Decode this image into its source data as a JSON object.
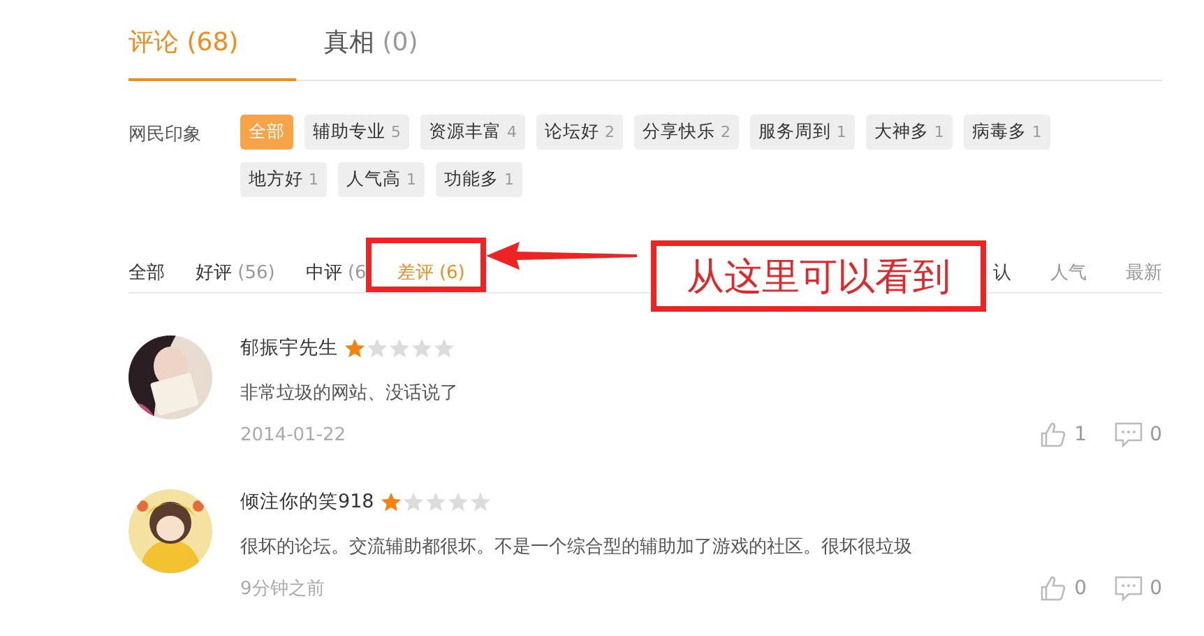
{
  "tabs": [
    {
      "label": "评论",
      "count": "(68)",
      "selected": true
    },
    {
      "label": "真相",
      "count": "(0)",
      "selected": false
    }
  ],
  "impressions": {
    "label": "网民印象",
    "tags": [
      {
        "label": "全部",
        "selected": true
      },
      {
        "label": "辅助专业",
        "count": "5",
        "selected": false
      },
      {
        "label": "资源丰富",
        "count": "4",
        "selected": false
      },
      {
        "label": "论坛好",
        "count": "2",
        "selected": false
      },
      {
        "label": "分享快乐",
        "count": "2",
        "selected": false
      },
      {
        "label": "服务周到",
        "count": "1",
        "selected": false
      },
      {
        "label": "大神多",
        "count": "1",
        "selected": false
      },
      {
        "label": "病毒多",
        "count": "1",
        "selected": false
      },
      {
        "label": "地方好",
        "count": "1",
        "selected": false
      },
      {
        "label": "人气高",
        "count": "1",
        "selected": false
      },
      {
        "label": "功能多",
        "count": "1",
        "selected": false
      }
    ]
  },
  "filters": [
    {
      "label": "全部",
      "selected": false
    },
    {
      "label": "好评",
      "count": "(56)",
      "selected": false
    },
    {
      "label": "中评",
      "count": "(6",
      "selected": false
    },
    {
      "label": "差评",
      "count": "(6)",
      "selected": true
    }
  ],
  "sort": [
    {
      "label": "认",
      "selected": true
    },
    {
      "label": "人气",
      "selected": false
    },
    {
      "label": "最新",
      "selected": false
    }
  ],
  "annotation": {
    "text": "从这里可以看到"
  },
  "comments": [
    {
      "user": "郁振宇先生",
      "stars": 1,
      "text": "非常垃圾的网站、没话说了",
      "time": "2014-01-22",
      "likes": "1",
      "replies": "0"
    },
    {
      "user": "倾注你的笑918",
      "stars": 1,
      "text": "很坏的论坛。交流辅助都很坏。不是一个综合型的辅助加了游戏的社区。很坏很垃圾",
      "time": "9分钟之前",
      "likes": "0",
      "replies": "0"
    }
  ]
}
